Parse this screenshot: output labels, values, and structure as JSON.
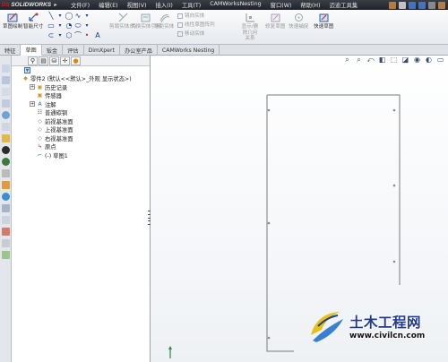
{
  "app": {
    "logo_prefix": "DS",
    "logo_text": "SOLIDWORKS"
  },
  "menu": [
    "文件(F)",
    "编辑(E)",
    "视图(V)",
    "插入(I)",
    "工具(T)",
    "CAMWorksNesting",
    "窗口(W)",
    "帮助(H)",
    "迈迪工具集"
  ],
  "commands": {
    "sketch": "草图绘制",
    "smart_dim": "智能尺寸",
    "trim": "剪裁实体(T)",
    "convert": "转换实体引用",
    "offset": "等距实体",
    "mirror": "镜向实体",
    "linear_pattern": "线性草图阵列",
    "move": "移动实体",
    "show_relations": "显示/删除几何关系",
    "repair": "修复草图",
    "quick_snap": "快速捕捉",
    "rapid_sketch": "快速草图"
  },
  "tabs": [
    "特征",
    "草图",
    "钣金",
    "评估",
    "DimXpert",
    "办公室产品",
    "CAMWorks Nesting"
  ],
  "active_tab": "草图",
  "tree": {
    "root": "零件2 (默认<<默认>_外观 显示状态>)",
    "items": [
      {
        "label": "历史记录",
        "icon": "history-icon",
        "expand": "+"
      },
      {
        "label": "传感器",
        "icon": "sensor-icon",
        "expand": ""
      },
      {
        "label": "注解",
        "icon": "annotation-icon",
        "expand": "+"
      },
      {
        "label": "普通碳钢",
        "icon": "material-icon",
        "expand": ""
      },
      {
        "label": "前视基准面",
        "icon": "plane-icon",
        "expand": ""
      },
      {
        "label": "上视基准面",
        "icon": "plane-icon",
        "expand": ""
      },
      {
        "label": "右视基准面",
        "icon": "plane-icon",
        "expand": ""
      },
      {
        "label": "原点",
        "icon": "origin-icon",
        "expand": ""
      },
      {
        "label": "(-) 草图1",
        "icon": "sketch-icon",
        "expand": ""
      }
    ]
  },
  "watermark": {
    "title": "土木工程网",
    "url": "www.civilcn.com"
  },
  "colors": {
    "titlebar": "#2a2e35",
    "accent": "#3571c2",
    "sketch_line": "#7a7a7a",
    "watermark_blue": "#223a8e"
  }
}
